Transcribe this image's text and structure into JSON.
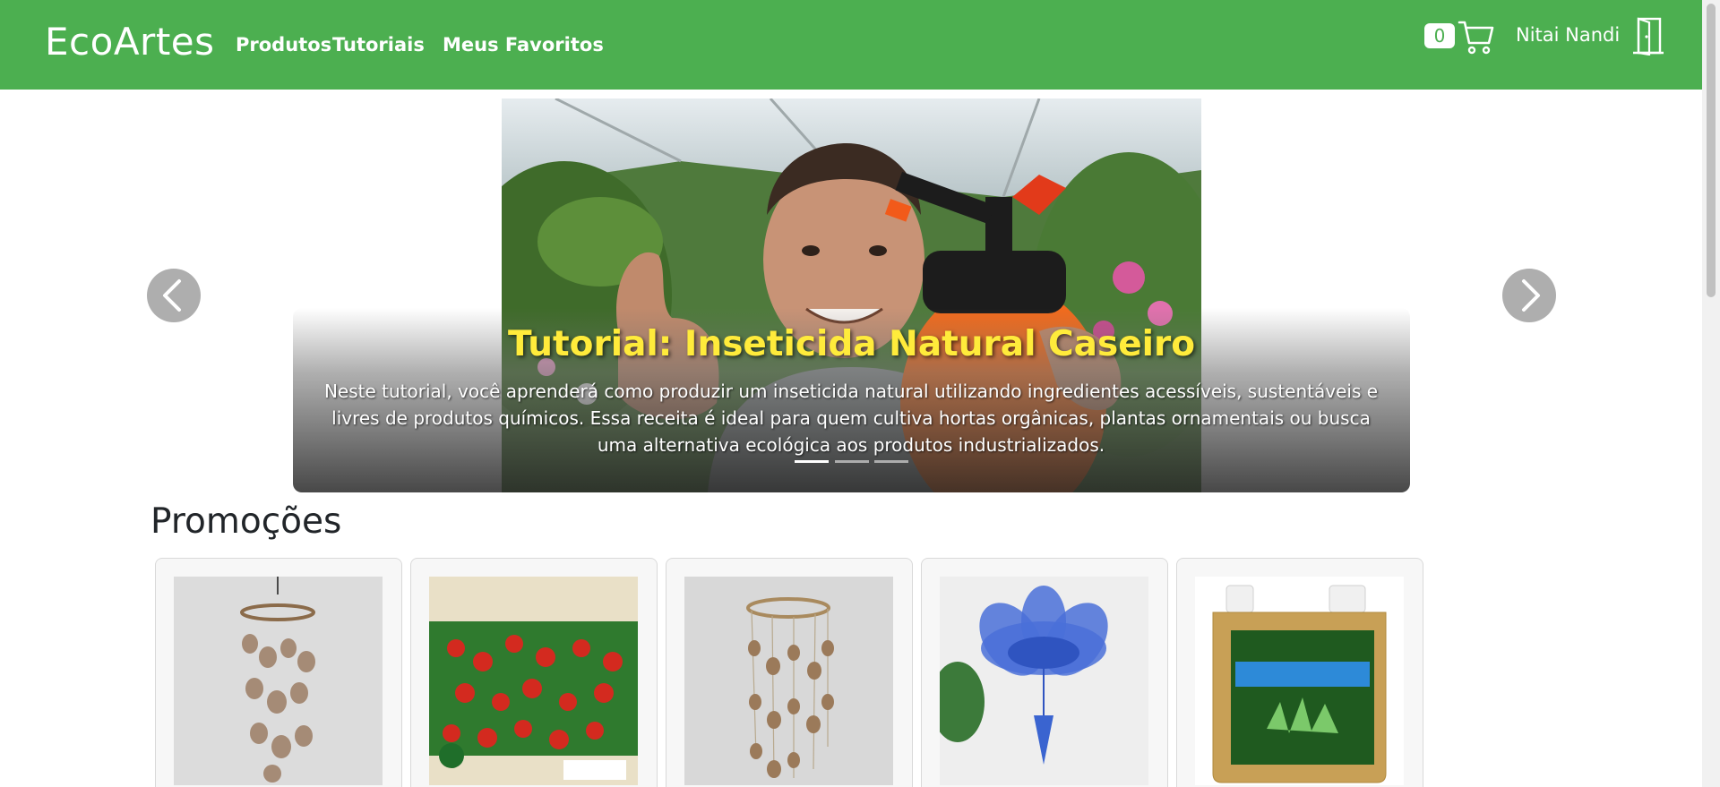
{
  "navbar": {
    "brand": "EcoArtes",
    "links": [
      "Produtos",
      "Tutoriais",
      "Meus Favoritos"
    ],
    "cart_count": "0",
    "user_name": "Nitai Nandi",
    "bg_color": "#4caf50"
  },
  "carousel": {
    "title": "Tutorial: Inseticida Natural Caseiro",
    "description": "Neste tutorial, você aprenderá como produzir um inseticida natural utilizando ingredientes acessíveis, sustentáveis e livres de produtos químicos. Essa receita é ideal para quem cultiva hortas orgânicas, plantas ornamentais ou busca uma alternativa ecológica aos produtos industrializados.",
    "active_index": 0,
    "slide_count": 3,
    "title_color": "#ffeb3b"
  },
  "promotions": {
    "title": "Promoções",
    "products": [
      {
        "image": "seashell-windchime-photo"
      },
      {
        "image": "tomato-seed-packet-photo"
      },
      {
        "image": "seashell-mobile-photo"
      },
      {
        "image": "blue-plastic-flower-photo"
      },
      {
        "image": "insecticide-bottle-photo"
      }
    ]
  }
}
